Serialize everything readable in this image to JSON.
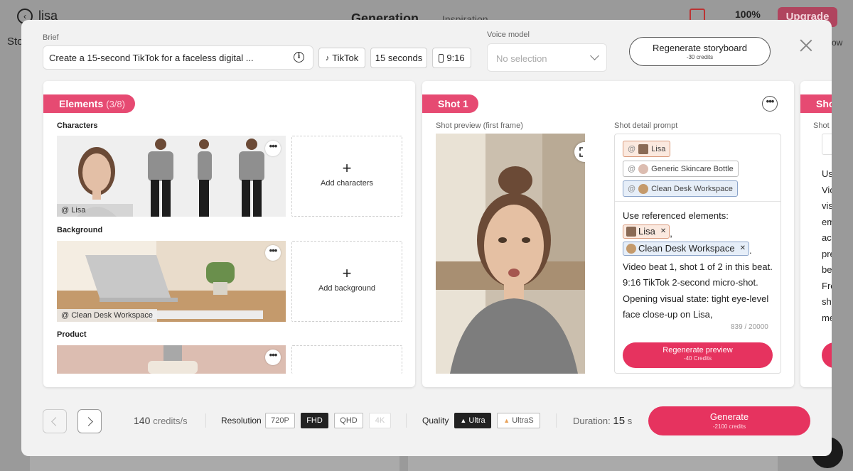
{
  "background": {
    "user_name": "lisa",
    "tab_generation": "Generation",
    "tab_inspiration": "Inspiration",
    "zoom": "100%",
    "upgrade": "Upgrade",
    "left_label": "Sto",
    "right_label": "ow"
  },
  "brief": {
    "label": "Brief",
    "value": "Create a 15-second TikTok for a faceless digital ...",
    "platform": "TikTok",
    "duration": "15 seconds",
    "aspect": "9:16"
  },
  "voice": {
    "label": "Voice model",
    "placeholder": "No selection"
  },
  "regenerate_storyboard": {
    "label": "Regenerate storyboard",
    "cost": "-30 credits"
  },
  "elements": {
    "title": "Elements",
    "count": "(3/8)",
    "characters_title": "Characters",
    "character_tag": "@ Lisa",
    "add_characters": "Add characters",
    "background_title": "Background",
    "background_tag": "@ Clean Desk Workspace",
    "add_background": "Add background",
    "product_title": "Product"
  },
  "shot1": {
    "title": "Shot 1",
    "preview_label": "Shot preview (first frame)",
    "prompt_label": "Shot detail prompt",
    "refs": [
      "Lisa",
      "Generic Skincare Bottle",
      "Clean Desk Workspace"
    ],
    "prompt_intro": "Use referenced elements:",
    "inline_ref_1": "Lisa",
    "inline_ref_2": "Clean Desk Workspace",
    "prompt_body": "Video beat 1, shot 1 of 2 in this beat. 9:16 TikTok 2-second micro-shot. Opening visual state: tight eye-level face close-up on Lisa,",
    "counter": "839 / 20000",
    "regen_label": "Regenerate preview",
    "regen_cost": "-40 Credits"
  },
  "shot2": {
    "title": "Sho",
    "label": "Shot",
    "text": [
      "Us",
      "Vic",
      "vis",
      "em",
      "ac",
      "pre",
      "be",
      "Fre",
      "sh",
      "me"
    ]
  },
  "footer": {
    "credits_value": "140",
    "credits_unit": "credits/s",
    "resolution_label": "Resolution",
    "resolutions": [
      "720P",
      "FHD",
      "QHD",
      "4K"
    ],
    "quality_label": "Quality",
    "quality_ultra": "Ultra",
    "quality_ultras": "UltraS",
    "duration_label": "Duration:",
    "duration_value": "15",
    "duration_unit": "s",
    "generate_label": "Generate",
    "generate_cost": "-2100 credits"
  },
  "colors": {
    "accent": "#e6335f",
    "pill": "#e64a72"
  }
}
